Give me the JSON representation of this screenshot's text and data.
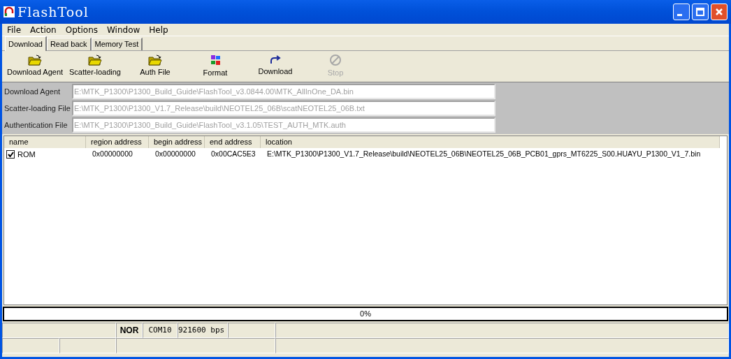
{
  "window": {
    "title": "FlashTool"
  },
  "menu": [
    {
      "label": "File"
    },
    {
      "label": "Action"
    },
    {
      "label": "Options"
    },
    {
      "label": "Window"
    },
    {
      "label": "Help"
    }
  ],
  "tabs": [
    {
      "label": "Download",
      "selected": true
    },
    {
      "label": "Read back",
      "selected": false
    },
    {
      "label": "Memory Test",
      "selected": false
    }
  ],
  "toolbar": [
    {
      "label": "Download Agent",
      "kind": "folder",
      "disabled": false
    },
    {
      "label": "Scatter-loading",
      "kind": "folder",
      "disabled": false
    },
    {
      "label": "Auth File",
      "kind": "folder",
      "disabled": false
    },
    {
      "label": "Format",
      "kind": "format",
      "disabled": false
    },
    {
      "label": "Download",
      "kind": "download",
      "disabled": false
    },
    {
      "label": "Stop",
      "kind": "stop",
      "disabled": true
    }
  ],
  "files": [
    {
      "label": "Download Agent",
      "value": "E:\\MTK_P1300\\P1300_Build_Guide\\FlashTool_v3.0844.00\\MTK_AllInOne_DA.bin"
    },
    {
      "label": "Scatter-loading File",
      "value": "E:\\MTK_P1300\\P1300_V1.7_Release\\build\\NEOTEL25_06B\\scatNEOTEL25_06B.txt"
    },
    {
      "label": "Authentication File",
      "value": "E:\\MTK_P1300\\P1300_Build_Guide\\FlashTool_v3.1.05\\TEST_AUTH_MTK.auth"
    }
  ],
  "table": {
    "columns": [
      "name",
      "region address",
      "begin address",
      "end address",
      "location"
    ],
    "rows": [
      {
        "checked": true,
        "cells": [
          "ROM",
          "0x00000000",
          "0x00000000",
          "0x00CAC5E3",
          "E:\\MTK_P1300\\P1300_V1.7_Release\\build\\NEOTEL25_06B\\NEOTEL25_06B_PCB01_gprs_MT6225_S00.HUAYU_P1300_V1_7.bin"
        ]
      }
    ]
  },
  "progress": {
    "level": 0,
    "reading": "0%"
  },
  "status_bar": {
    "memory": "NOR",
    "port": "COM10",
    "baud": "921600 bps"
  }
}
